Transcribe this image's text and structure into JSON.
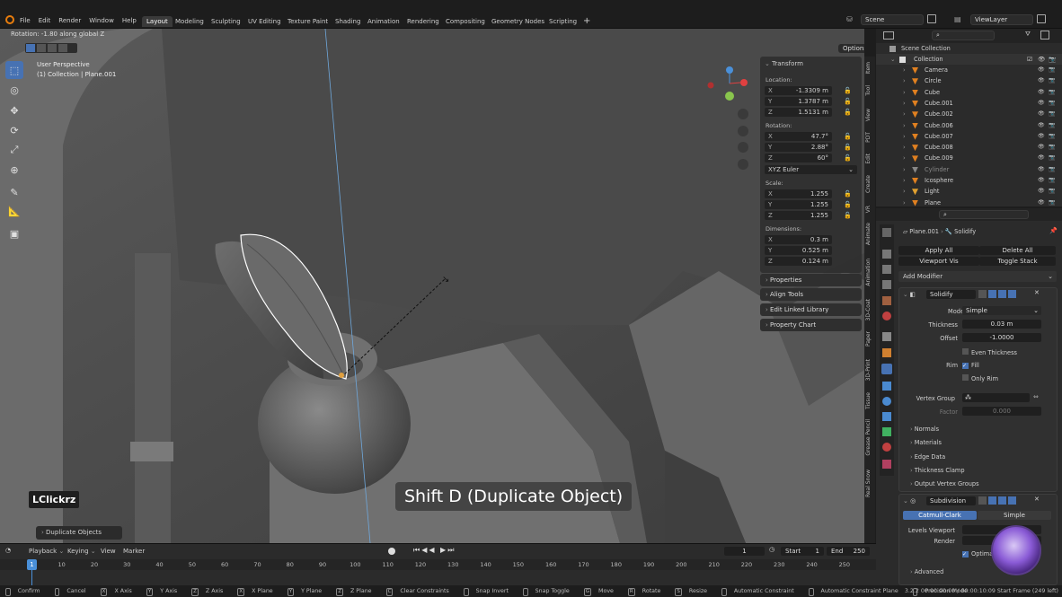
{
  "topbar": {
    "menus": [
      "File",
      "Edit",
      "Render",
      "Window",
      "Help"
    ],
    "workspaces": [
      "Layout",
      "Modeling",
      "Sculpting",
      "UV Editing",
      "Texture Paint",
      "Shading",
      "Animation",
      "Rendering",
      "Compositing",
      "Geometry Nodes",
      "Scripting"
    ],
    "scene": "Scene",
    "view_layer": "ViewLayer"
  },
  "viewport": {
    "operator_status": "Rotation: -1.80 along global Z",
    "perspective": "User Perspective",
    "collection_info": "(1) Collection | Plane.001",
    "options_label": "Options",
    "overlay_text": "Shift D (Duplicate Object)",
    "brand_label": "LClickrz",
    "last_op": "Duplicate Objects"
  },
  "npanel": {
    "title": "Transform",
    "location_label": "Location:",
    "loc": {
      "x": "-1.3309 m",
      "y": "1.3787 m",
      "z": "1.5131 m"
    },
    "rotation_label": "Rotation:",
    "rot": {
      "x": "47.7°",
      "y": "2.88°",
      "z": "60°"
    },
    "rot_mode": "XYZ Euler",
    "scale_label": "Scale:",
    "scale": {
      "x": "1.255",
      "y": "1.255",
      "z": "1.255"
    },
    "dim_label": "Dimensions:",
    "dim": {
      "x": "0.3 m",
      "y": "0.525 m",
      "z": "0.124 m"
    },
    "axis": {
      "x": "X",
      "y": "Y",
      "z": "Z"
    },
    "sections": [
      "Properties",
      "Align Tools",
      "Edit Linked Library",
      "Property Chart"
    ]
  },
  "vertical_tabs": [
    "Item",
    "Tool",
    "View",
    "PDT",
    "Edit",
    "Create",
    "VR",
    "Animate",
    "Animation",
    "3D-Coat",
    "Paper",
    "3D-Print",
    "Tissue",
    "Grease Pencil",
    "Real Snow"
  ],
  "outliner": {
    "root": "Scene Collection",
    "collection": "Collection",
    "items": [
      "Camera",
      "Circle",
      "Cube",
      "Cube.001",
      "Cube.002",
      "Cube.006",
      "Cube.007",
      "Cube.008",
      "Cube.009",
      "Cylinder",
      "Icosphere",
      "Light",
      "Plane"
    ]
  },
  "properties": {
    "breadcrumb_object": "Plane.001",
    "breadcrumb_modifier": "Solidify",
    "apply_all": "Apply All",
    "delete_all": "Delete All",
    "viewport_vis": "Viewport Vis",
    "toggle_stack": "Toggle Stack",
    "add_modifier": "Add Modifier",
    "solidify": {
      "name": "Solidify",
      "mode_label": "Mode",
      "mode": "Simple",
      "thickness_label": "Thickness",
      "thickness": "0.03 m",
      "offset_label": "Offset",
      "offset": "-1.0000",
      "even_thickness": "Even Thickness",
      "rim_label": "Rim",
      "fill": "Fill",
      "only_rim": "Only Rim",
      "vertex_group_label": "Vertex Group",
      "factor_label": "Factor",
      "factor": "0.000",
      "subpanels": [
        "Normals",
        "Materials",
        "Edge Data",
        "Thickness Clamp",
        "Output Vertex Groups"
      ]
    },
    "subdivision": {
      "name": "Subdivision",
      "catmull": "Catmull-Clark",
      "simple": "Simple",
      "levels_label": "Levels Viewport",
      "render_label": "Render",
      "optimal": "Optima",
      "advanced": "Advanced"
    }
  },
  "timeline": {
    "playback": "Playback",
    "keying": "Keying",
    "view": "View",
    "marker": "Marker",
    "current_frame": "1",
    "start_label": "Start",
    "start": "1",
    "end_label": "End",
    "end": "250",
    "ticks": [
      "1",
      "10",
      "20",
      "30",
      "40",
      "50",
      "60",
      "70",
      "80",
      "90",
      "100",
      "110",
      "120",
      "130",
      "140",
      "150",
      "160",
      "170",
      "180",
      "190",
      "200",
      "210",
      "220",
      "230",
      "240",
      "250"
    ]
  },
  "statusbar": {
    "items": [
      [
        "",
        "Confirm"
      ],
      [
        "",
        "Cancel"
      ],
      [
        "X",
        "X Axis"
      ],
      [
        "Y",
        "Y Axis"
      ],
      [
        "Z",
        "Z Axis"
      ],
      [
        "X",
        "X Plane"
      ],
      [
        "Y",
        "Y Plane"
      ],
      [
        "Z",
        "Z Plane"
      ],
      [
        "C",
        "Clear Constraints"
      ],
      [
        "",
        "Snap Invert"
      ],
      [
        "",
        "Snap Toggle"
      ],
      [
        "G",
        "Move"
      ],
      [
        "R",
        "Rotate"
      ],
      [
        "S",
        "Resize"
      ],
      [
        "",
        "Automatic Constraint"
      ],
      [
        "",
        "Automatic Constraint Plane"
      ],
      [
        "",
        "Precision Mode"
      ]
    ],
    "version": "3.2.2  00:00:00:00 / 00:00:10:09  Start Frame (249 left)"
  },
  "colors": {
    "accent": "#4772b3",
    "timeline_playhead": "#4a90d9",
    "outline_highlight": "#ffffff"
  }
}
